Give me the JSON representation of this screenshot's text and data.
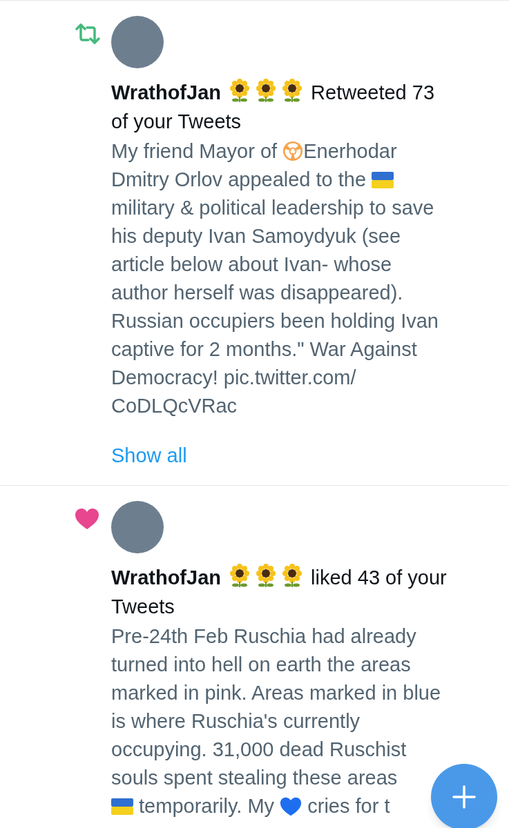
{
  "notifications": [
    {
      "kind": "retweet",
      "name": "WrathofJan",
      "action": [
        "Retweeted 73",
        "of your Tweets"
      ],
      "lines": [
        [
          {
            "kind": "text",
            "text": "My friend Mayor of "
          },
          {
            "kind": "radiation"
          },
          {
            "kind": "text",
            "text": "Enerhodar"
          }
        ],
        [
          {
            "kind": "text",
            "text": "Dmitry Orlov appealed to the "
          },
          {
            "kind": "flag"
          }
        ],
        [
          {
            "kind": "text",
            "text": "military & political leadership to save"
          }
        ],
        [
          {
            "kind": "text",
            "text": "his deputy Ivan Samoydyuk (see"
          }
        ],
        [
          {
            "kind": "text",
            "text": "article below about Ivan- whose"
          }
        ],
        [
          {
            "kind": "text",
            "text": "author herself was disappeared)."
          }
        ],
        [
          {
            "kind": "text",
            "text": "Russian occupiers been holding Ivan"
          }
        ],
        [
          {
            "kind": "text",
            "text": "captive for 2 months.\" War Against"
          }
        ],
        [
          {
            "kind": "text",
            "text": "Democracy! pic.twitter.com/"
          }
        ],
        [
          {
            "kind": "text",
            "text": "CoDLQcVRac"
          }
        ]
      ],
      "show_all": "Show all"
    },
    {
      "kind": "like",
      "name": "WrathofJan",
      "action": [
        "liked 43 of your",
        "Tweets"
      ],
      "lines": [
        [
          {
            "kind": "text",
            "text": "Pre-24th Feb Ruschia had already"
          }
        ],
        [
          {
            "kind": "text",
            "text": "turned into hell on earth the areas"
          }
        ],
        [
          {
            "kind": "text",
            "text": "marked in pink. Areas marked in blue"
          }
        ],
        [
          {
            "kind": "text",
            "text": "is where Ruschia's currently"
          }
        ],
        [
          {
            "kind": "text",
            "text": "occupying. 31,000 dead Ruschist"
          }
        ],
        [
          {
            "kind": "text",
            "text": "souls spent stealing these areas"
          }
        ],
        [
          {
            "kind": "flag"
          },
          {
            "kind": "text",
            "text": " temporarily. My "
          },
          {
            "kind": "heart"
          },
          {
            "kind": "text",
            "text": " cries for t"
          }
        ]
      ]
    }
  ]
}
